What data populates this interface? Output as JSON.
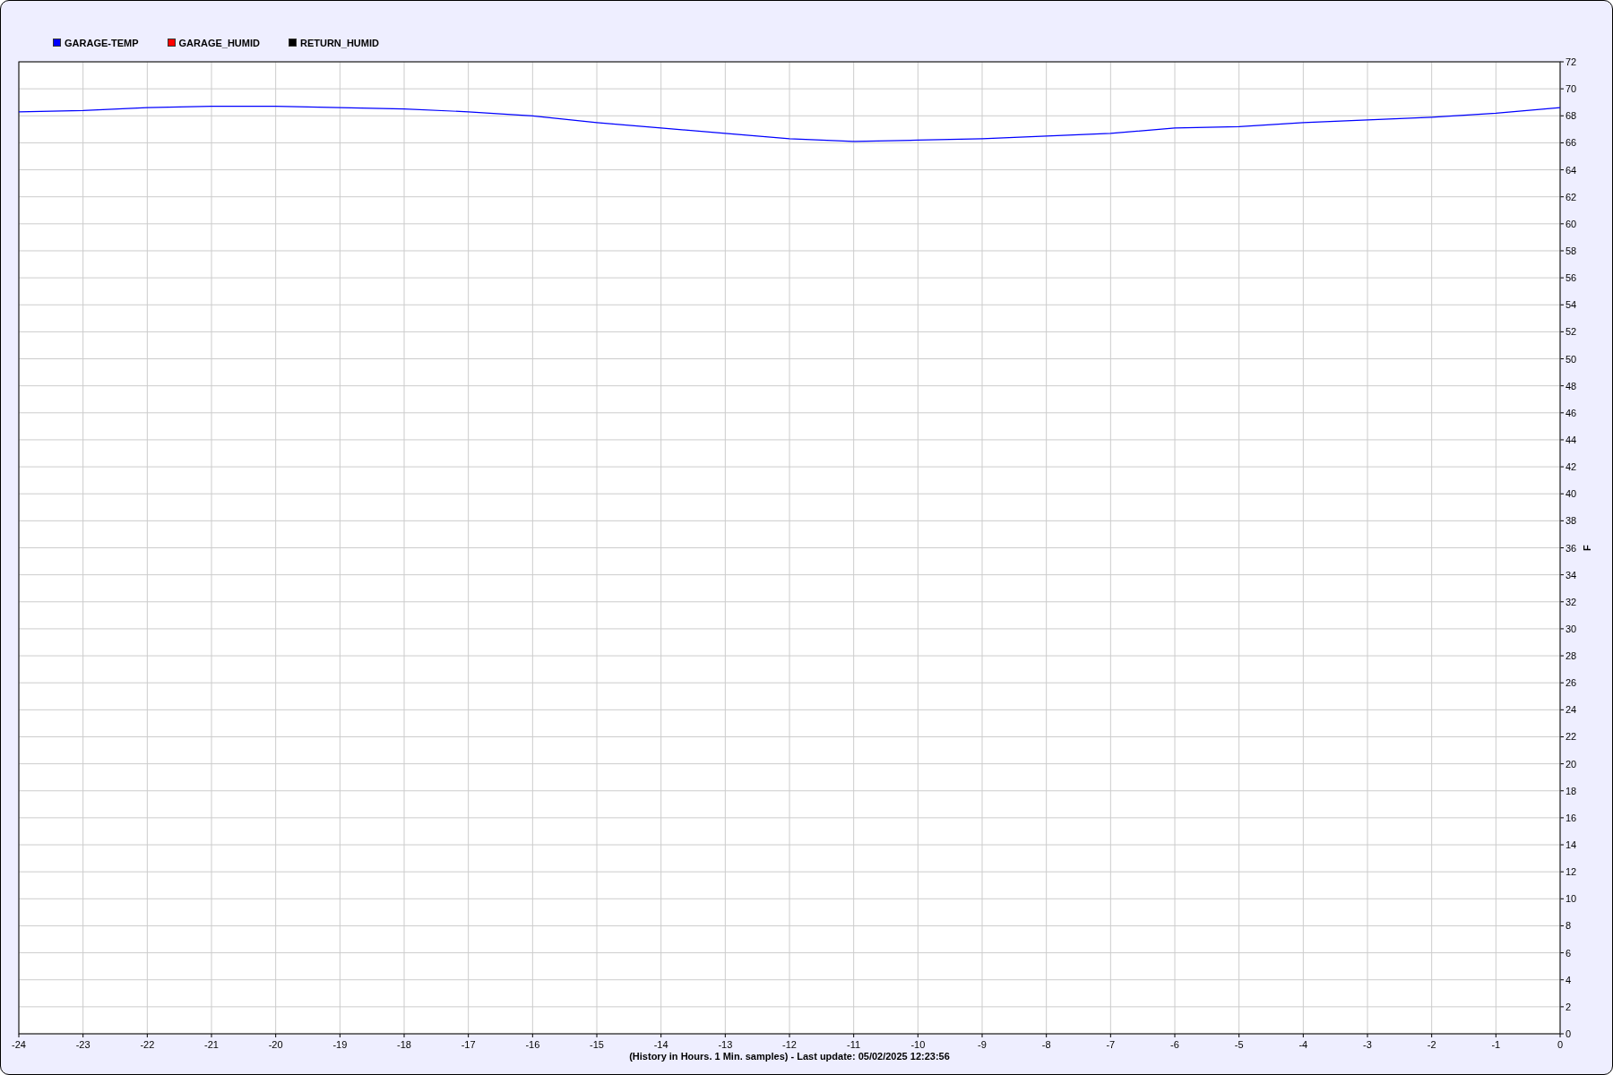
{
  "chart": {
    "chart_data": {
      "type": "line",
      "grid": true,
      "xlabel": "(History in Hours. 1 Min. samples) - Last update: 05/02/2025 12:23:56",
      "ylabel": "F",
      "x": [
        -24,
        -23,
        -22,
        -21,
        -20,
        -19,
        -18,
        -17,
        -16,
        -15,
        -14,
        -13,
        -12,
        -11,
        -10,
        -9,
        -8,
        -7,
        -6,
        -5,
        -4,
        -3,
        -2,
        -1,
        0
      ],
      "series": [
        {
          "name": "GARAGE-TEMP",
          "color": "#0000ff",
          "values": [
            68.3,
            68.4,
            68.6,
            68.7,
            68.7,
            68.6,
            68.5,
            68.3,
            68.0,
            67.5,
            67.1,
            66.7,
            66.3,
            66.1,
            66.2,
            66.3,
            66.5,
            66.7,
            67.1,
            67.2,
            67.5,
            67.7,
            67.9,
            68.2,
            68.6
          ]
        },
        {
          "name": "GARAGE_HUMID",
          "color": "#ff0000",
          "values": [
            null,
            null,
            null,
            null,
            null,
            null,
            null,
            null,
            null,
            null,
            null,
            null,
            null,
            null,
            null,
            null,
            null,
            null,
            null,
            null,
            null,
            null,
            null,
            null,
            null
          ]
        },
        {
          "name": "RETURN_HUMID",
          "color": "#000000",
          "values": [
            null,
            null,
            null,
            null,
            null,
            null,
            null,
            null,
            null,
            null,
            null,
            null,
            null,
            null,
            null,
            null,
            null,
            null,
            null,
            null,
            null,
            null,
            null,
            null,
            null
          ]
        }
      ],
      "xlim": [
        -24,
        0
      ],
      "ylim": [
        0,
        72
      ],
      "xticks": [
        -24,
        -23,
        -22,
        -21,
        -20,
        -19,
        -18,
        -17,
        -16,
        -15,
        -14,
        -13,
        -12,
        -11,
        -10,
        -9,
        -8,
        -7,
        -6,
        -5,
        -4,
        -3,
        -2,
        -1,
        0
      ],
      "yticks": [
        0,
        2,
        4,
        6,
        8,
        10,
        12,
        14,
        16,
        18,
        20,
        22,
        24,
        26,
        28,
        30,
        32,
        34,
        36,
        38,
        40,
        42,
        44,
        46,
        48,
        50,
        52,
        54,
        56,
        58,
        60,
        62,
        64,
        66,
        68,
        70,
        72
      ]
    }
  }
}
